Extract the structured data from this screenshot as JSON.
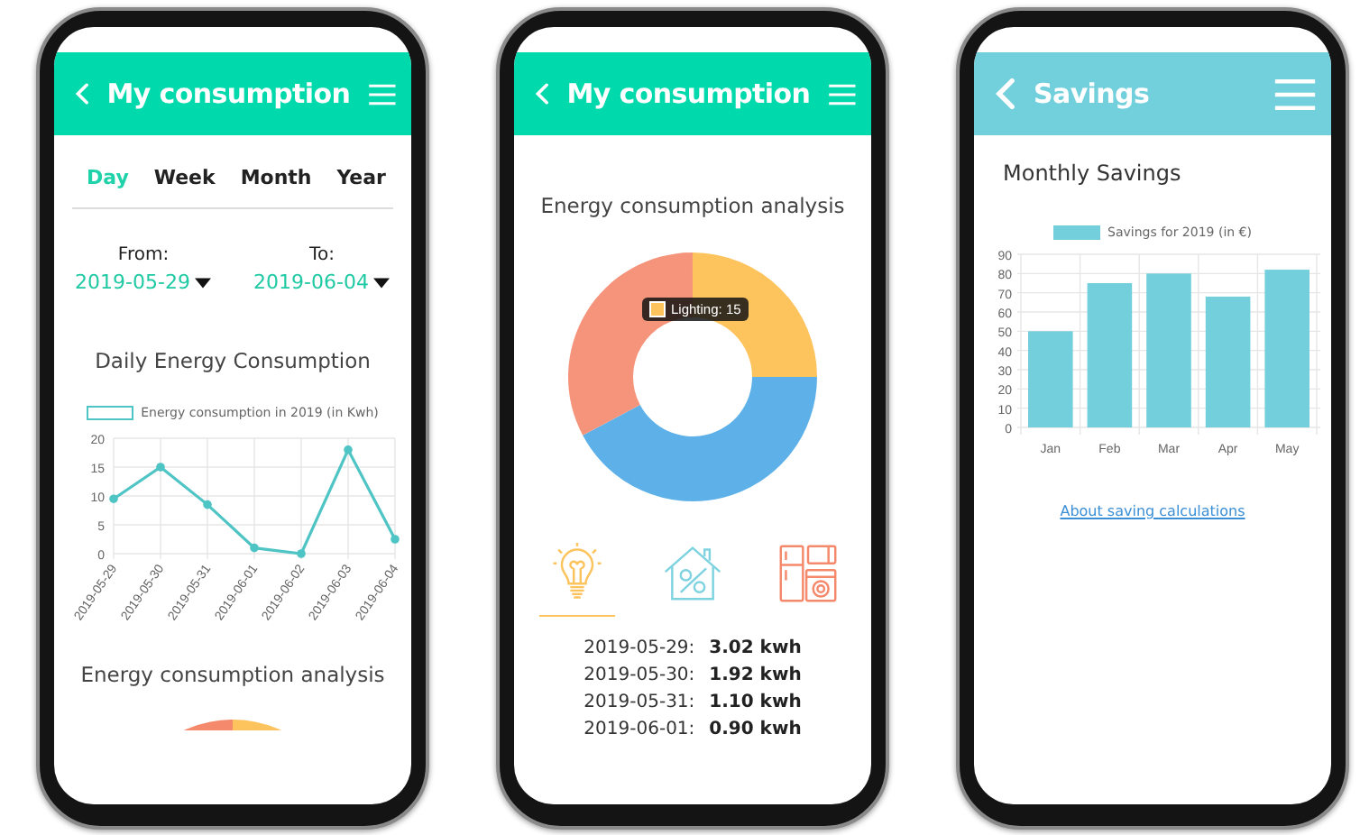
{
  "daily": {
    "header": {
      "title": "My consumption"
    },
    "periods": [
      {
        "label": "Day",
        "selected": true
      },
      {
        "label": "Week",
        "selected": false
      },
      {
        "label": "Month",
        "selected": false
      },
      {
        "label": "Year",
        "selected": false
      }
    ],
    "from": {
      "label": "From:",
      "value": "2019-05-29"
    },
    "to": {
      "label": "To:",
      "value": "2019-06-04"
    },
    "chart_data": {
      "type": "line",
      "title": "Daily Energy Consumption",
      "categories": [
        "2019-05-29",
        "2019-05-30",
        "2019-05-31",
        "2019-06-01",
        "2019-06-02",
        "2019-06-03",
        "2019-06-04"
      ],
      "series": [
        {
          "name": "Energy consumption in 2019 (in Kwh)",
          "color": "#4fc4c4",
          "marker": true,
          "values": [
            9.5,
            15,
            8.5,
            1,
            0,
            18,
            2.5
          ]
        }
      ],
      "grid": true,
      "ylim": [
        0,
        20
      ],
      "yticks": [
        0,
        5,
        10,
        15,
        20
      ]
    },
    "section_title": "Energy consumption analysis"
  },
  "analysis": {
    "header": {
      "title": "My consumption"
    },
    "title": "Energy consumption analysis",
    "tooltip": "Lighting: 15",
    "categories": [
      {
        "kind": "bulb",
        "selected": true,
        "color": "#fdc35c"
      },
      {
        "kind": "house",
        "selected": false,
        "color": "#7fd3e0"
      },
      {
        "kind": "appliances",
        "selected": false,
        "color": "#f5896b"
      }
    ],
    "rows": [
      {
        "date": "2019-05-29:",
        "amount": "3.02 kwh"
      },
      {
        "date": "2019-05-30:",
        "amount": "1.92 kwh"
      },
      {
        "date": "2019-05-31:",
        "amount": "1.10 kwh"
      },
      {
        "date": "2019-06-01:",
        "amount": "0.90 kwh"
      }
    ]
  },
  "savings": {
    "header": {
      "title": "Savings"
    },
    "title": "Monthly Savings",
    "chart_data": {
      "type": "bar",
      "categories": [
        "Jan",
        "Feb",
        "Mar",
        "Apr",
        "May"
      ],
      "series": [
        {
          "name": "Savings for 2019 (in €)",
          "color": "#74cfdd",
          "values": [
            50,
            75,
            80,
            68,
            82
          ]
        }
      ],
      "grid": true,
      "ylim": [
        0,
        90
      ],
      "yticks": [
        0,
        10,
        20,
        30,
        40,
        50,
        60,
        70,
        80,
        90
      ]
    },
    "link": "About saving calculations"
  }
}
